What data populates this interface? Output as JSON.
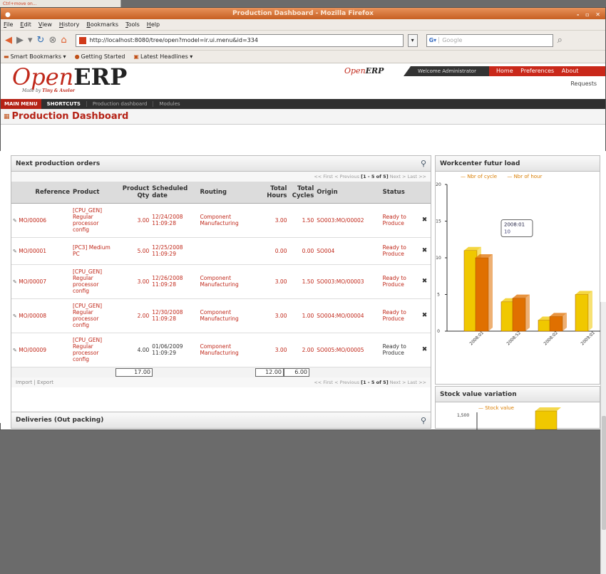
{
  "bg_tab": {
    "label": "Ctrl+move on..."
  },
  "window": {
    "title": "Production Dashboard - Mozilla Firefox",
    "controls": "- ▫ ✕"
  },
  "menu": [
    "File",
    "Edit",
    "View",
    "History",
    "Bookmarks",
    "Tools",
    "Help"
  ],
  "nav": {
    "url": "http://localhost:8080/tree/open?model=ir.ui.menu&id=334",
    "search_placeholder": "Google"
  },
  "bookmarks": [
    "Smart Bookmarks ▾",
    "Getting Started",
    "Latest Headlines ▾"
  ],
  "erp": {
    "logo_open": "Open",
    "logo_erp": "ERP",
    "tagline_pre": "Made by",
    "tagline_brand": "Tiny & Axelor",
    "small_logo_open": "Open",
    "small_logo_erp": "ERP",
    "welcome": "Welcome Administrator",
    "top_links": [
      "Home",
      "Preferences",
      "About"
    ],
    "requests": "Requests"
  },
  "mainnav": {
    "main_menu": "MAIN MENU",
    "shortcuts": "SHORTCUTS",
    "items": [
      "Production dashboard",
      "Modules"
    ]
  },
  "page": {
    "title": "Production Dashboard"
  },
  "orders": {
    "title": "Next production orders",
    "pager": {
      "first": "<< First",
      "prev": "< Previous",
      "count": "[1 - 5 of 5]",
      "next": "Next >",
      "last": "Last >>"
    },
    "columns": [
      "Reference",
      "Product",
      "Product Qty",
      "Scheduled date",
      "Routing",
      "Total Hours",
      "Total Cycles",
      "Origin",
      "Status"
    ],
    "rows": [
      {
        "ref": "MO/00006",
        "product": "[CPU_GEN] Regular processor config",
        "qty": "3.00",
        "date": "12/24/2008 11:09:28",
        "routing": "Component Manufacturing",
        "hours": "3.00",
        "cycles": "1.50",
        "origin": "SO003:MO/00002",
        "status": "Ready to Produce"
      },
      {
        "ref": "MO/00001",
        "product": "[PC3] Medium PC",
        "qty": "5.00",
        "date": "12/25/2008 11:09:29",
        "routing": "",
        "hours": "0.00",
        "cycles": "0.00",
        "origin": "SO004",
        "status": "Ready to Produce"
      },
      {
        "ref": "MO/00007",
        "product": "[CPU_GEN] Regular processor config",
        "qty": "3.00",
        "date": "12/26/2008 11:09:28",
        "routing": "Component Manufacturing",
        "hours": "3.00",
        "cycles": "1.50",
        "origin": "SO003:MO/00003",
        "status": "Ready to Produce"
      },
      {
        "ref": "MO/00008",
        "product": "[CPU_GEN] Regular processor config",
        "qty": "2.00",
        "date": "12/30/2008 11:09:28",
        "routing": "Component Manufacturing",
        "hours": "3.00",
        "cycles": "1.00",
        "origin": "SO004:MO/00004",
        "status": "Ready to Produce"
      },
      {
        "ref": "MO/00009",
        "product": "[CPU_GEN] Regular processor config",
        "qty": "4.00",
        "date": "01/06/2009 11:09:29",
        "routing": "Component Manufacturing",
        "hours": "3.00",
        "cycles": "2.00",
        "origin": "SO005:MO/00005",
        "status": "Ready to Produce"
      }
    ],
    "totals": {
      "qty": "17.00",
      "hours": "12.00",
      "cycles": "6.00"
    },
    "import_export": "Import | Export"
  },
  "deliveries": {
    "title": "Deliveries (Out packing)"
  },
  "workcenter": {
    "title": "Workcenter futur load",
    "tooltip_label": "2008:01",
    "tooltip_value": "10"
  },
  "stock": {
    "title": "Stock value variation",
    "legend": "Stock value",
    "first_tick": "1,500"
  },
  "chart_data": [
    {
      "type": "bar",
      "title": "Workcenter futur load",
      "categories": [
        "2008:01",
        "2008:52",
        "2008:02",
        "2009:01"
      ],
      "series": [
        {
          "name": "Nbr of cycle",
          "values": [
            11,
            4,
            1.5,
            5
          ],
          "color": "#f0c800"
        },
        {
          "name": "Nbr of hour",
          "values": [
            10,
            4.5,
            2,
            0
          ],
          "color": "#e07000"
        }
      ],
      "yticks": [
        "20",
        "15",
        "10",
        "5",
        "0"
      ],
      "ylim": [
        0,
        20
      ]
    },
    {
      "type": "bar",
      "title": "Stock value variation",
      "series": [
        {
          "name": "Stock value",
          "values": [
            1200
          ],
          "color": "#f0c800"
        }
      ],
      "yticks": [
        "1,500"
      ]
    }
  ],
  "colors": {
    "accent": "#c0281a",
    "bar_yellow": "#f0c800",
    "bar_orange": "#e07000"
  }
}
